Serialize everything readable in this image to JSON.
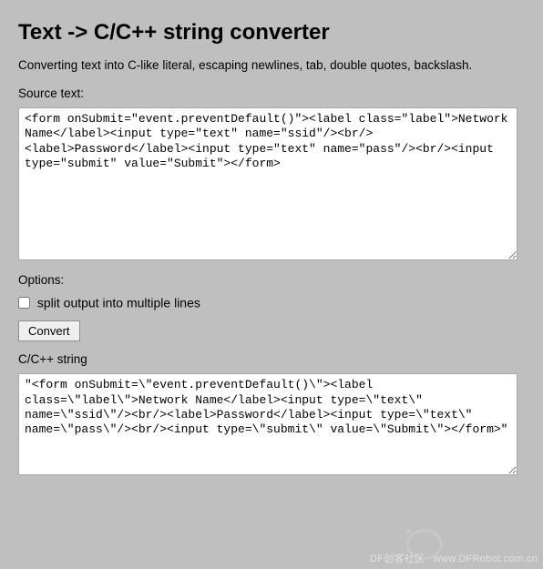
{
  "page": {
    "title": "Text -> C/C++ string converter",
    "description": "Converting text into C-like literal, escaping newlines, tab, double quotes, backslash."
  },
  "source": {
    "label": "Source text:",
    "value": "<form onSubmit=\"event.preventDefault()\"><label class=\"label\">Network Name</label><input type=\"text\" name=\"ssid\"/><br/><label>Password</label><input type=\"text\" name=\"pass\"/><br/><input type=\"submit\" value=\"Submit\"></form>"
  },
  "options": {
    "label": "Options:",
    "split": {
      "label": "split output into multiple lines",
      "checked": false
    }
  },
  "actions": {
    "convert_label": "Convert"
  },
  "output": {
    "label": "C/C++ string",
    "value": "\"<form onSubmit=\\\"event.preventDefault()\\\"><label class=\\\"label\\\">Network Name</label><input type=\\\"text\\\" name=\\\"ssid\\\"/><br/><label>Password</label><input type=\\\"text\\\" name=\\\"pass\\\"/><br/><input type=\\\"submit\\\" value=\\\"Submit\\\"></form>\""
  },
  "watermark": {
    "cn": "DF创客社区",
    "url": "www.DFRobot.com.cn"
  }
}
